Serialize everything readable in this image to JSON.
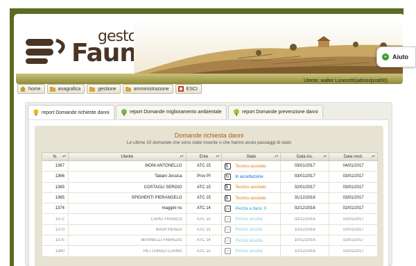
{
  "app": {
    "logo_top": "gesto",
    "logo_bottom": "Fauna"
  },
  "user": {
    "line": "Utente: walter Lunezetti(admin/prod/I0)"
  },
  "help": {
    "label": "Aiuto",
    "icon": "plus-circle-icon"
  },
  "menu": [
    {
      "label": "home",
      "icon": "home-icon"
    },
    {
      "label": "anagrafica",
      "icon": "folder-icon"
    },
    {
      "label": "gestione",
      "icon": "folder-icon"
    },
    {
      "label": "amministrazione",
      "icon": "folder-icon"
    },
    {
      "label": "ESCI",
      "icon": "exit-icon"
    }
  ],
  "tabs": [
    {
      "label": "report Domande richieste danni",
      "icon": "lightbulb-icon",
      "active": true
    },
    {
      "label": "report Domande miglioramento ambientale",
      "icon": "tree-icon",
      "active": false
    },
    {
      "label": "report Domande prevenzione danni",
      "icon": "tree-icon",
      "active": false
    }
  ],
  "list": {
    "title": "Domande richiesta danni",
    "subtitle": "Le ultime 10 domande che sono state inserite o che hanno avuto passaggi di stato",
    "columns": [
      "N.",
      "Utente",
      "Ente",
      "Stato",
      "Data ins.",
      "Data mod."
    ],
    "rows": [
      {
        "n": "1367",
        "utente": "MONI ANTONELLO",
        "ente": "ATC 15",
        "stato": "Tecnico assolato",
        "stato_color": "orange",
        "ins": "03/01/2017",
        "mod": "04/01/2017"
      },
      {
        "n": "1366",
        "utente": "Tabani Jessica",
        "ente": "Prov PI",
        "stato": "In accettazione",
        "stato_color": "blue",
        "ins": "03/01/2017",
        "mod": "03/01/2017"
      },
      {
        "n": "1365",
        "utente": "COSTAGLI SERGIO",
        "ente": "ATC 15",
        "stato": "Tecnico assolato",
        "stato_color": "orange",
        "ins": "02/01/2017",
        "mod": "03/01/2017"
      },
      {
        "n": "1365",
        "utente": "SPIGHENTI PIERANGELO",
        "ente": "ATC 15",
        "stato": "Tecnico assolato",
        "stato_color": "orange",
        "ins": "31/12/2016",
        "mod": "03/01/2017"
      },
      {
        "n": "1374",
        "utente": "maggini ns",
        "ente": "ATC 14",
        "stato": "Perizia a darsi: 0",
        "stato_color": "cyan",
        "ins": "02/12/2016",
        "mod": "02/01/2017"
      },
      {
        "n": "1372",
        "utente": "CAPEI FRANCO",
        "ente": "ATC 15",
        "stato": "Perizia assolta",
        "stato_color": "cyan",
        "ins": "02/12/2016",
        "mod": "02/01/2017"
      },
      {
        "n": "1370",
        "utente": "BADII RENZA",
        "ente": "ATC 15",
        "stato": "Perizia assolta",
        "stato_color": "cyan",
        "ins": "10/12/2016",
        "mod": "02/01/2017"
      },
      {
        "n": "1375",
        "utente": "MANNELLI FABRIZIO",
        "ente": "ATC 14",
        "stato": "Perizia assolta",
        "stato_color": "cyan",
        "ins": "10/12/2016",
        "mod": "02/01/2017"
      },
      {
        "n": "1380",
        "utente": "PETTORALI LUANO",
        "ente": "ATC 15",
        "stato": "Perizia assolta",
        "stato_color": "cyan",
        "ins": "10/12/2016",
        "mod": "02/01/2017"
      }
    ]
  }
}
